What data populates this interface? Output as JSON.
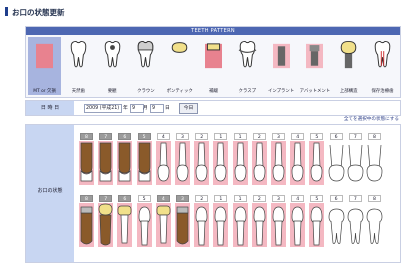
{
  "header": {
    "title": "お口の状態更新"
  },
  "palette": {
    "title": "TEETH PATTERN",
    "tools": [
      {
        "label": "MT or 欠損",
        "icon": "missing-tooth-icon",
        "selected": true
      },
      {
        "label": "天然歯",
        "icon": "natural-tooth-icon",
        "selected": false
      },
      {
        "label": "要観",
        "icon": "caries-tooth-icon",
        "selected": false
      },
      {
        "label": "クラウン",
        "icon": "crown-tooth-icon",
        "selected": false
      },
      {
        "label": "ポンティック",
        "icon": "pontic-tooth-icon",
        "selected": false
      },
      {
        "label": "補綴",
        "icon": "filling-tooth-icon",
        "selected": false
      },
      {
        "label": "クラスプ",
        "icon": "clasp-tooth-icon",
        "selected": false
      },
      {
        "label": "インプラント",
        "icon": "implant-icon",
        "selected": false
      },
      {
        "label": "アバットメント",
        "icon": "abutment-icon",
        "selected": false
      },
      {
        "label": "上部構造",
        "icon": "superstructure-icon",
        "selected": false
      },
      {
        "label": "保存治療歯",
        "icon": "treated-tooth-icon",
        "selected": false
      }
    ]
  },
  "date": {
    "label": "日 時 日",
    "year": "2009 (平成21)",
    "year_unit": "年",
    "month": "9",
    "month_unit": "月",
    "day": "9",
    "day_unit": "日",
    "today_button": "今日"
  },
  "note": "全てを選択中の状態にする",
  "chart": {
    "label": "お口の状態",
    "upper": [
      {
        "num": "8",
        "type": "root"
      },
      {
        "num": "7",
        "type": "root"
      },
      {
        "num": "6",
        "type": "root"
      },
      {
        "num": "5",
        "type": "root"
      },
      {
        "num": "4",
        "type": "incisor"
      },
      {
        "num": "3",
        "type": "incisor"
      },
      {
        "num": "2",
        "type": "incisor"
      },
      {
        "num": "1",
        "type": "incisor"
      },
      {
        "num": "1",
        "type": "incisor"
      },
      {
        "num": "2",
        "type": "incisor"
      },
      {
        "num": "3",
        "type": "incisor"
      },
      {
        "num": "4",
        "type": "incisor"
      },
      {
        "num": "5",
        "type": "incisor"
      },
      {
        "num": "6",
        "type": "molar"
      },
      {
        "num": "7",
        "type": "molar"
      },
      {
        "num": "8",
        "type": "molar"
      }
    ],
    "lower": [
      {
        "num": "8",
        "type": "root"
      },
      {
        "num": "7",
        "type": "crown"
      },
      {
        "num": "6",
        "type": "bridge"
      },
      {
        "num": "5",
        "type": "incisor"
      },
      {
        "num": "4",
        "type": "bridge"
      },
      {
        "num": "3",
        "type": "root"
      },
      {
        "num": "2",
        "type": "incisor"
      },
      {
        "num": "1",
        "type": "incisor"
      },
      {
        "num": "1",
        "type": "incisor"
      },
      {
        "num": "2",
        "type": "incisor"
      },
      {
        "num": "3",
        "type": "incisor"
      },
      {
        "num": "4",
        "type": "incisor"
      },
      {
        "num": "5",
        "type": "incisor"
      },
      {
        "num": "6",
        "type": "molar"
      },
      {
        "num": "7",
        "type": "molar"
      },
      {
        "num": "8",
        "type": "molar"
      }
    ]
  },
  "colors": {
    "accent": "#4d67b2",
    "pink": "#f4b8c2",
    "gum": "#e8828f",
    "root": "#8a5a2a",
    "gold": "#f1e08a"
  }
}
